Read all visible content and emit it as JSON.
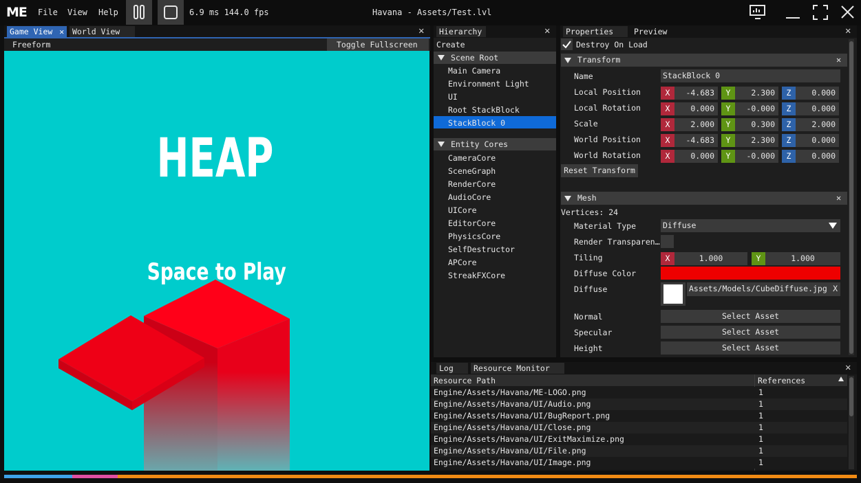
{
  "app": {
    "logo": "ME",
    "menu": [
      "File",
      "View",
      "Help"
    ],
    "perf": "6.9 ms 144.0 fps",
    "title": "Havana - Assets/Test.lvl",
    "icons": [
      "pause-icon",
      "stop-icon",
      "monitor-icon",
      "minimize-icon",
      "maximize-icon",
      "close-icon"
    ]
  },
  "game_view": {
    "tabs": [
      "Game View",
      "World View"
    ],
    "toolbar": {
      "mode": "Freeform",
      "fullscreen": "Toggle Fullscreen"
    },
    "scene": {
      "title": "HEAP",
      "subtitle": "Space to Play",
      "bg": "#00cccc",
      "block_color": "#ff0018"
    }
  },
  "hierarchy": {
    "tab": "Hierarchy",
    "create": "Create",
    "scene_root": "Scene Root",
    "scene_items": [
      "Main Camera",
      "Environment Light",
      "UI",
      "Root StackBlock",
      "StackBlock 0"
    ],
    "selected": "StackBlock 0",
    "entity_cores": "Entity Cores",
    "core_items": [
      "CameraCore",
      "SceneGraph",
      "RenderCore",
      "AudioCore",
      "UICore",
      "EditorCore",
      "PhysicsCore",
      "SelfDestructor",
      "APCore",
      "StreakFXCore"
    ]
  },
  "properties": {
    "tabs": [
      "Properties",
      "Preview"
    ],
    "destroy_on_load": "Destroy On Load",
    "transform": {
      "header": "Transform",
      "name_label": "Name",
      "name_value": "StackBlock 0",
      "rows": [
        {
          "label": "Local Position",
          "x": "-4.683",
          "y": "2.300",
          "z": "0.000"
        },
        {
          "label": "Local Rotation",
          "x": "0.000",
          "y": "-0.000",
          "z": "0.000"
        },
        {
          "label": "Scale",
          "x": "2.000",
          "y": "0.300",
          "z": "2.000"
        },
        {
          "label": "World Position",
          "x": "-4.683",
          "y": "2.300",
          "z": "0.000"
        },
        {
          "label": "World Rotation",
          "x": "0.000",
          "y": "-0.000",
          "z": "0.000"
        }
      ],
      "axis_labels": [
        "X",
        "Y",
        "Z"
      ],
      "reset": "Reset Transform"
    },
    "mesh": {
      "header": "Mesh",
      "vertices": "Vertices: 24",
      "material_type_label": "Material Type",
      "material_type_value": "Diffuse",
      "render_transparent_label": "Render Transparen…",
      "tiling_label": "Tiling",
      "tiling_x": "1.000",
      "tiling_y": "1.000",
      "diffuse_color_label": "Diffuse Color",
      "diffuse_color": "#ee0000",
      "diffuse_label": "Diffuse",
      "diffuse_path": "Assets/Models/CubeDiffuse.jpg",
      "diffuse_clear": "X",
      "normal_label": "Normal",
      "specular_label": "Specular",
      "height_label": "Height",
      "select_asset": "Select Asset"
    }
  },
  "bottom": {
    "tabs": [
      "Log",
      "Resource Monitor"
    ],
    "columns": [
      "Resource Path",
      "References"
    ],
    "rows": [
      {
        "path": "Engine/Assets/Havana/ME-LOGO.png",
        "refs": "1"
      },
      {
        "path": "Engine/Assets/Havana/UI/Audio.png",
        "refs": "1"
      },
      {
        "path": "Engine/Assets/Havana/UI/BugReport.png",
        "refs": "1"
      },
      {
        "path": "Engine/Assets/Havana/UI/Close.png",
        "refs": "1"
      },
      {
        "path": "Engine/Assets/Havana/UI/ExitMaximize.png",
        "refs": "1"
      },
      {
        "path": "Engine/Assets/Havana/UI/File.png",
        "refs": "1"
      },
      {
        "path": "Engine/Assets/Havana/UI/Image.png",
        "refs": "1"
      }
    ]
  },
  "colors": {
    "accent": "#2f65b3",
    "selected": "#0f6ad8",
    "progress": [
      "#3ea1e8",
      "#e14fa1",
      "#f08a14"
    ]
  }
}
